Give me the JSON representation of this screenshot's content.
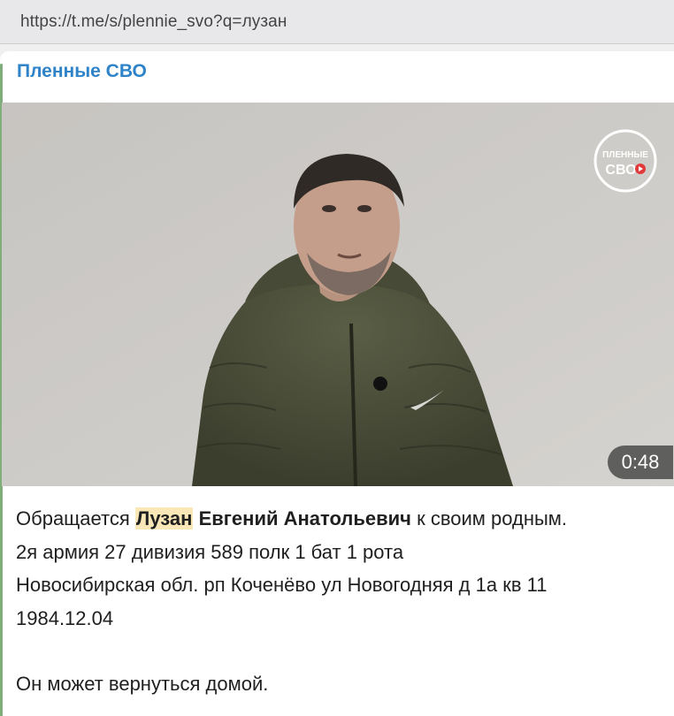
{
  "browser": {
    "url": "https://t.me/s/plennie_svo?q=лузан"
  },
  "post": {
    "channel_name": "Пленные СВО",
    "video": {
      "duration": "0:48",
      "logo_text_top": "ПЛЕННЫЕ",
      "logo_text_bottom": "СВО"
    },
    "message": {
      "line1_prefix": "Обращается ",
      "line1_highlight": "Лузан",
      "line1_bold": " Евгений Анатольевич",
      "line1_suffix": " к своим родным.",
      "line2": "2я армия 27 дивизия 589 полк 1 бат 1 рота",
      "line3": "Новосибирская обл. рп Коченёво ул Новогодняя д 1а кв 11",
      "line4": "1984.12.04",
      "line5": "Он может вернуться домой."
    }
  }
}
